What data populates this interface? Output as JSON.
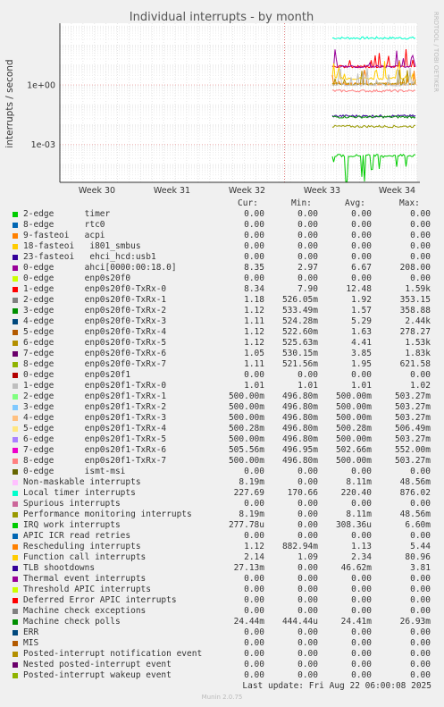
{
  "chart_data": {
    "type": "line",
    "title": "Individual interrupts - by month",
    "ylabel": "interrupts / second",
    "xlabel": "",
    "y_scale": "log",
    "y_ticks": [
      "1e+00",
      "1e-03"
    ],
    "x_ticks": [
      "Week 30",
      "Week 31",
      "Week 32",
      "Week 33",
      "Week 34"
    ],
    "watermark": "RRDTOOL / TOBI OETIKER",
    "grid": true,
    "columns": [
      "Cur:",
      "Min:",
      "Avg:",
      "Max:"
    ],
    "series": [
      {
        "name": "2-edge      timer",
        "color": "#00cc00",
        "values": [
          "0.00",
          "0.00",
          "0.00",
          "0.00"
        ]
      },
      {
        "name": "8-edge      rtc0",
        "color": "#0066b3",
        "values": [
          "0.00",
          "0.00",
          "0.00",
          "0.00"
        ]
      },
      {
        "name": "9-fasteoi   acpi",
        "color": "#ff8000",
        "values": [
          "0.00",
          "0.00",
          "0.00",
          "0.00"
        ]
      },
      {
        "name": "18-fasteoi   i801_smbus",
        "color": "#ffcc00",
        "values": [
          "0.00",
          "0.00",
          "0.00",
          "0.00"
        ]
      },
      {
        "name": "23-fasteoi   ehci_hcd:usb1",
        "color": "#330099",
        "values": [
          "0.00",
          "0.00",
          "0.00",
          "0.00"
        ]
      },
      {
        "name": "0-edge      ahci[0000:00:18.0]",
        "color": "#990099",
        "values": [
          "8.35",
          "2.97",
          "6.67",
          "208.00"
        ]
      },
      {
        "name": "0-edge      enp0s20f0",
        "color": "#ccff00",
        "values": [
          "0.00",
          "0.00",
          "0.00",
          "0.00"
        ]
      },
      {
        "name": "1-edge      enp0s20f0-TxRx-0",
        "color": "#ff0000",
        "values": [
          "8.34",
          "7.90",
          "12.48",
          "1.59k"
        ]
      },
      {
        "name": "2-edge      enp0s20f0-TxRx-1",
        "color": "#808080",
        "values": [
          "1.18",
          "526.05m",
          "1.92",
          "353.15"
        ]
      },
      {
        "name": "3-edge      enp0s20f0-TxRx-2",
        "color": "#008f00",
        "values": [
          "1.12",
          "533.49m",
          "1.57",
          "358.88"
        ]
      },
      {
        "name": "4-edge      enp0s20f0-TxRx-3",
        "color": "#00487d",
        "values": [
          "1.11",
          "524.28m",
          "5.29",
          "2.44k"
        ]
      },
      {
        "name": "5-edge      enp0s20f0-TxRx-4",
        "color": "#b35a00",
        "values": [
          "1.12",
          "522.60m",
          "1.63",
          "278.27"
        ]
      },
      {
        "name": "6-edge      enp0s20f0-TxRx-5",
        "color": "#b38f00",
        "values": [
          "1.12",
          "525.63m",
          "4.41",
          "1.53k"
        ]
      },
      {
        "name": "7-edge      enp0s20f0-TxRx-6",
        "color": "#6b006b",
        "values": [
          "1.05",
          "530.15m",
          "3.85",
          "1.83k"
        ]
      },
      {
        "name": "8-edge      enp0s20f0-TxRx-7",
        "color": "#8fb300",
        "values": [
          "1.11",
          "521.56m",
          "1.95",
          "621.58"
        ]
      },
      {
        "name": "0-edge      enp0s20f1",
        "color": "#b30000",
        "values": [
          "0.00",
          "0.00",
          "0.00",
          "0.00"
        ]
      },
      {
        "name": "1-edge      enp0s20f1-TxRx-0",
        "color": "#bebebe",
        "values": [
          "1.01",
          "1.01",
          "1.01",
          "1.02"
        ]
      },
      {
        "name": "2-edge      enp0s20f1-TxRx-1",
        "color": "#80ff80",
        "values": [
          "500.00m",
          "496.80m",
          "500.00m",
          "503.27m"
        ]
      },
      {
        "name": "3-edge      enp0s20f1-TxRx-2",
        "color": "#80c9ff",
        "values": [
          "500.00m",
          "496.80m",
          "500.00m",
          "503.27m"
        ]
      },
      {
        "name": "4-edge      enp0s20f1-TxRx-3",
        "color": "#ffc080",
        "values": [
          "500.00m",
          "496.80m",
          "500.00m",
          "503.27m"
        ]
      },
      {
        "name": "5-edge      enp0s20f1-TxRx-4",
        "color": "#ffe680",
        "values": [
          "500.28m",
          "496.80m",
          "500.28m",
          "506.49m"
        ]
      },
      {
        "name": "6-edge      enp0s20f1-TxRx-5",
        "color": "#aa80ff",
        "values": [
          "500.00m",
          "496.80m",
          "500.00m",
          "503.27m"
        ]
      },
      {
        "name": "7-edge      enp0s20f1-TxRx-6",
        "color": "#ee00cc",
        "values": [
          "505.56m",
          "496.95m",
          "502.66m",
          "552.00m"
        ]
      },
      {
        "name": "8-edge      enp0s20f1-TxRx-7",
        "color": "#ff8080",
        "values": [
          "500.00m",
          "496.80m",
          "500.00m",
          "503.27m"
        ]
      },
      {
        "name": "0-edge      ismt-msi",
        "color": "#666600",
        "values": [
          "0.00",
          "0.00",
          "0.00",
          "0.00"
        ]
      },
      {
        "name": "Non-maskable interrupts",
        "color": "#ffbfff",
        "values": [
          "8.19m",
          "0.00",
          "8.11m",
          "48.56m"
        ]
      },
      {
        "name": "Local timer interrupts",
        "color": "#00ffcc",
        "values": [
          "227.69",
          "170.66",
          "220.40",
          "876.02"
        ]
      },
      {
        "name": "Spurious interrupts",
        "color": "#cc6699",
        "values": [
          "0.00",
          "0.00",
          "0.00",
          "0.00"
        ]
      },
      {
        "name": "Performance monitoring interrupts",
        "color": "#999900",
        "values": [
          "8.19m",
          "0.00",
          "8.11m",
          "48.56m"
        ]
      },
      {
        "name": "IRQ work interrupts",
        "color": "#00cc00",
        "values": [
          "277.78u",
          "0.00",
          "308.36u",
          "6.60m"
        ]
      },
      {
        "name": "APIC ICR read retries",
        "color": "#0066b3",
        "values": [
          "0.00",
          "0.00",
          "0.00",
          "0.00"
        ]
      },
      {
        "name": "Rescheduling interrupts",
        "color": "#ff8000",
        "values": [
          "1.12",
          "882.94m",
          "1.13",
          "5.44"
        ]
      },
      {
        "name": "Function call interrupts",
        "color": "#ffcc00",
        "values": [
          "2.14",
          "1.09",
          "2.34",
          "80.96"
        ]
      },
      {
        "name": "TLB shootdowns",
        "color": "#330099",
        "values": [
          "27.13m",
          "0.00",
          "46.62m",
          "3.81"
        ]
      },
      {
        "name": "Thermal event interrupts",
        "color": "#990099",
        "values": [
          "0.00",
          "0.00",
          "0.00",
          "0.00"
        ]
      },
      {
        "name": "Threshold APIC interrupts",
        "color": "#ccff00",
        "values": [
          "0.00",
          "0.00",
          "0.00",
          "0.00"
        ]
      },
      {
        "name": "Deferred Error APIC interrupts",
        "color": "#ff0000",
        "values": [
          "0.00",
          "0.00",
          "0.00",
          "0.00"
        ]
      },
      {
        "name": "Machine check exceptions",
        "color": "#808080",
        "values": [
          "0.00",
          "0.00",
          "0.00",
          "0.00"
        ]
      },
      {
        "name": "Machine check polls",
        "color": "#008f00",
        "values": [
          "24.44m",
          "444.44u",
          "24.41m",
          "26.93m"
        ]
      },
      {
        "name": "ERR",
        "color": "#00487d",
        "values": [
          "0.00",
          "0.00",
          "0.00",
          "0.00"
        ]
      },
      {
        "name": "MIS",
        "color": "#b35a00",
        "values": [
          "0.00",
          "0.00",
          "0.00",
          "0.00"
        ]
      },
      {
        "name": "Posted-interrupt notification event",
        "color": "#b38f00",
        "values": [
          "0.00",
          "0.00",
          "0.00",
          "0.00"
        ]
      },
      {
        "name": "Nested posted-interrupt event",
        "color": "#6b006b",
        "values": [
          "0.00",
          "0.00",
          "0.00",
          "0.00"
        ]
      },
      {
        "name": "Posted-interrupt wakeup event",
        "color": "#8fb300",
        "values": [
          "0.00",
          "0.00",
          "0.00",
          "0.00"
        ]
      }
    ],
    "plot_traces": [
      {
        "label": "Local timer interrupts",
        "color": "#00ffcc",
        "level": 227.69
      },
      {
        "label": "1-edge enp0s20f0-TxRx-0",
        "color": "#ff0000",
        "level": 8.34
      },
      {
        "label": "0-edge ahci[0000:00:18.0]",
        "color": "#990099",
        "level": 8.35
      },
      {
        "label": "Function call interrupts",
        "color": "#ffcc00",
        "level": 2.14
      },
      {
        "label": "Rescheduling interrupts",
        "color": "#ff8000",
        "level": 1.12
      },
      {
        "label": "6-edge enp0s20f0-TxRx-5",
        "color": "#b38f00",
        "level": 1.12
      },
      {
        "label": "1-edge enp0s20f1-TxRx-0",
        "color": "#bebebe",
        "level": 1.01
      },
      {
        "label": "8-edge enp0s20f1-TxRx-7",
        "color": "#ff8080",
        "level": 0.5
      },
      {
        "label": "TLB shootdowns",
        "color": "#330099",
        "level": 0.02713
      },
      {
        "label": "Machine check polls",
        "color": "#008f00",
        "level": 0.02444
      },
      {
        "label": "Performance monitoring interrupts",
        "color": "#999900",
        "level": 0.00819
      },
      {
        "label": "IRQ work interrupts",
        "color": "#00cc00",
        "level": 0.00027778
      }
    ]
  },
  "footer": {
    "last_update": "Last update: Fri Aug 22 06:00:08 2025",
    "generator": "Munin 2.0.75"
  }
}
